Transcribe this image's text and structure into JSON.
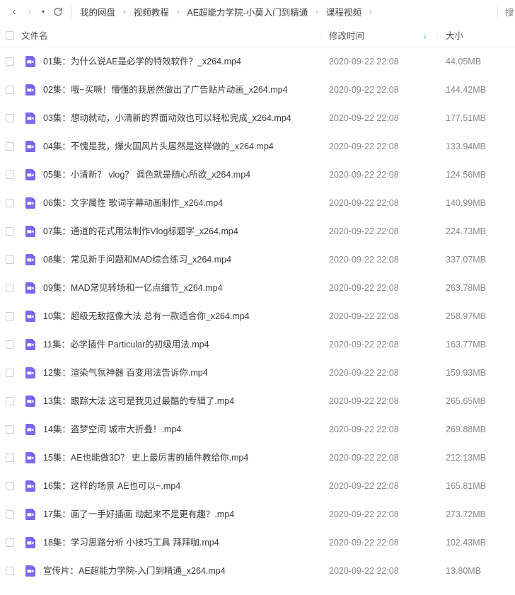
{
  "toolbar": {
    "back_icon": "chevron-left-icon",
    "forward_icon": "chevron-right-icon",
    "history_icon": "caret-down-icon",
    "refresh_icon": "refresh-icon",
    "back_label": "‹",
    "forward_label": "›",
    "history_label": "▾",
    "refresh_label": "↻",
    "search_label": "搜"
  },
  "breadcrumb": {
    "separator": "›",
    "items": [
      "我的网盘",
      "视频教程",
      "AE超能力学院-小莫入门到精通",
      "课程视频"
    ]
  },
  "table": {
    "columns": {
      "name": "文件名",
      "modified": "修改时间",
      "size": "大小"
    },
    "sort": {
      "column": "修改时间",
      "direction": "desc",
      "glyph": "↓"
    },
    "accent_color": "#2b9bf4",
    "file_icon_color": "#7b68ee",
    "rows": [
      {
        "icon": "video-file-icon",
        "name": "01集：为什么说AE是必学的特效软件？_x264.mp4",
        "modified": "2020-09-22 22:08",
        "size": "44.05MB"
      },
      {
        "icon": "video-file-icon",
        "name": "02集：哦~买噘！懵懂的我居然做出了广告贴片动画_x264.mp4",
        "modified": "2020-09-22 22:08",
        "size": "144.42MB"
      },
      {
        "icon": "video-file-icon",
        "name": "03集：想动就动，小清新的界面动效也可以轻松完成_x264.mp4",
        "modified": "2020-09-22 22:08",
        "size": "177.51MB"
      },
      {
        "icon": "video-file-icon",
        "name": "04集：不愧是我，爆火国风片头居然是这样做的_x264.mp4",
        "modified": "2020-09-22 22:08",
        "size": "133.94MB"
      },
      {
        "icon": "video-file-icon",
        "name": "05集：小清新？ vlog？ 调色就是随心所欲_x264.mp4",
        "modified": "2020-09-22 22:08",
        "size": "124.56MB"
      },
      {
        "icon": "video-file-icon",
        "name": "06集：文字属性 歌词字幕动画制作_x264.mp4",
        "modified": "2020-09-22 22:08",
        "size": "140.99MB"
      },
      {
        "icon": "video-file-icon",
        "name": "07集：通道的花式用法制作Vlog标题字_x264.mp4",
        "modified": "2020-09-22 22:08",
        "size": "224.73MB"
      },
      {
        "icon": "video-file-icon",
        "name": "08集：常见新手问题和MAD综合练习_x264.mp4",
        "modified": "2020-09-22 22:08",
        "size": "337.07MB"
      },
      {
        "icon": "video-file-icon",
        "name": "09集：MAD常见转场和一亿点细节_x264.mp4",
        "modified": "2020-09-22 22:08",
        "size": "263.78MB"
      },
      {
        "icon": "video-file-icon",
        "name": "10集：超级无敌抠像大法 总有一款适合你_x264.mp4",
        "modified": "2020-09-22 22:08",
        "size": "258.97MB"
      },
      {
        "icon": "video-file-icon",
        "name": "11集：必学插件 Particular的初级用法.mp4",
        "modified": "2020-09-22 22:08",
        "size": "163.77MB"
      },
      {
        "icon": "video-file-icon",
        "name": "12集：渲染气氛神器 百变用法告诉你.mp4",
        "modified": "2020-09-22 22:08",
        "size": "159.93MB"
      },
      {
        "icon": "video-file-icon",
        "name": "13集：跟踪大法 这可是我见过最酷的专辑了.mp4",
        "modified": "2020-09-22 22:08",
        "size": "265.65MB"
      },
      {
        "icon": "video-file-icon",
        "name": "14集：盗梦空间 城市大折叠！.mp4",
        "modified": "2020-09-22 22:08",
        "size": "269.88MB"
      },
      {
        "icon": "video-file-icon",
        "name": "15集：AE也能做3D？ 史上最厉害的插件教给你.mp4",
        "modified": "2020-09-22 22:08",
        "size": "212.13MB"
      },
      {
        "icon": "video-file-icon",
        "name": "16集：这样的场景 AE也可以~.mp4",
        "modified": "2020-09-22 22:08",
        "size": "165.81MB"
      },
      {
        "icon": "video-file-icon",
        "name": "17集：画了一手好插画 动起来不是更有趣？.mp4",
        "modified": "2020-09-22 22:08",
        "size": "273.72MB"
      },
      {
        "icon": "video-file-icon",
        "name": "18集：学习思路分析 小技巧工具 拜拜咖.mp4",
        "modified": "2020-09-22 22:08",
        "size": "102.43MB"
      },
      {
        "icon": "video-file-icon",
        "name": "宣传片：AE超能力学院-入门到精通_x264.mp4",
        "modified": "2020-09-22 22:08",
        "size": "13.80MB"
      }
    ]
  }
}
